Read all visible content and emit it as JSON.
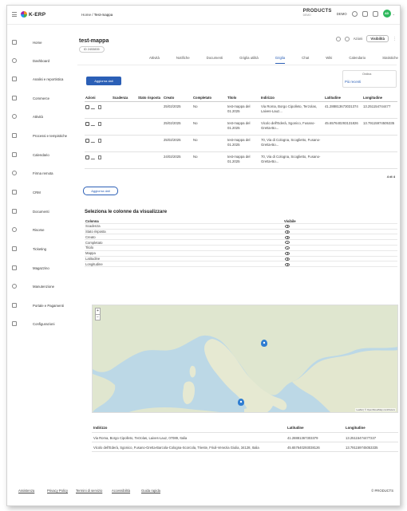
{
  "app": {
    "logo_text": "K-ERP"
  },
  "breadcrumb": {
    "home": "Home",
    "sep": "/",
    "current": "Test-mappa"
  },
  "header": {
    "product_name": "PRODUCTS",
    "product_sub": "DEMO",
    "org": "DEMO",
    "avatar_text": "AD"
  },
  "sidebar": {
    "items": [
      {
        "label": "Home",
        "icon": "home-icon"
      },
      {
        "label": "Dashboard",
        "icon": "dashboard-icon"
      },
      {
        "label": "Analisi e reportistica",
        "icon": "chart-icon"
      },
      {
        "label": "Commerce",
        "icon": "cart-icon"
      },
      {
        "label": "Attività",
        "icon": "activity-icon"
      },
      {
        "label": "Processi e tempistiche",
        "icon": "hourglass-icon"
      },
      {
        "label": "Calendario",
        "icon": "calendar-icon"
      },
      {
        "label": "Firma remota",
        "icon": "signature-icon"
      },
      {
        "label": "CRM",
        "icon": "crm-icon"
      },
      {
        "label": "Documenti",
        "icon": "document-icon"
      },
      {
        "label": "Risorse",
        "icon": "resources-icon"
      },
      {
        "label": "Ticketing",
        "icon": "ticket-icon"
      },
      {
        "label": "Magazzino",
        "icon": "warehouse-icon"
      },
      {
        "label": "Manutenzione",
        "icon": "wrench-icon"
      },
      {
        "label": "Portale e Pagamenti",
        "icon": "portal-icon"
      },
      {
        "label": "Configurazioni",
        "icon": "gear-icon"
      }
    ]
  },
  "page": {
    "title": "test-mappa",
    "id_badge": "ID 2453835",
    "actions": {
      "menu_label": "Azioni",
      "select_value": "Visibilità"
    }
  },
  "tabs": [
    "Attività",
    "Notifiche",
    "Documenti",
    "Griglia utilità",
    "Griglia",
    "Chat",
    "Wiki",
    "Calendario",
    "Statistiche"
  ],
  "active_tab": "Griglia",
  "buttons": {
    "update_top": "Aggiorna dati",
    "update_bottom": "Aggiorna dati"
  },
  "filter": {
    "caption": "Ordina",
    "value": "Più recenti"
  },
  "grid": {
    "columns": [
      "Azioni",
      "Scadenza",
      "Stato risposta",
      "Creato",
      "Completato",
      "Titolo",
      "Indirizzo",
      "Latitudine",
      "Longitudine"
    ],
    "rows": [
      {
        "scadenza": "",
        "stato": "",
        "creato": "25/02/2025",
        "completato": "No",
        "titolo": "test-mappa del 01.2025",
        "indirizzo": "Via Roma, Borgo Cipolleto, Terzolas, Laives-Lauz...",
        "lat": "41.288813673031374",
        "lon": "13.251154744477"
      },
      {
        "scadenza": "",
        "stato": "",
        "creato": "25/02/2025",
        "completato": "No",
        "titolo": "test-mappa del 01.2025",
        "indirizzo": "Vicolo dell'Ederà, Sgonico, Fusano-Gretta-Bo...",
        "lat": "45.657640293131826",
        "lon": "13.79115974505335"
      },
      {
        "scadenza": "",
        "stato": "",
        "creato": "25/02/2025",
        "completato": "No",
        "titolo": "test-mappa del 01.2025",
        "indirizzo": "70, Via di Cologna, Scoglietto, Fusano-Gretta-Bo...",
        "lat": "",
        "lon": ""
      },
      {
        "scadenza": "",
        "stato": "",
        "creato": "24/02/2025",
        "completato": "No",
        "titolo": "test-mappa del 01.2025",
        "indirizzo": "70, Via di Cologna, Scoglietto, Fusano-Gretta-Bo...",
        "lat": "",
        "lon": ""
      }
    ],
    "page_indicator": "4 di 4"
  },
  "column_picker": {
    "title": "Seleziona le colonne da visualizzare",
    "head_name": "Colonna",
    "head_visible": "Visibile",
    "items": [
      "Scadenza",
      "Stato risposta",
      "Creato",
      "Completato",
      "Titolo",
      "Mappa",
      "Latitudine",
      "Longitudine"
    ]
  },
  "map": {
    "zoom_in": "+",
    "zoom_out": "−",
    "attribution": "Leaflet | © OpenStreetMap contributors"
  },
  "addresses": {
    "head": {
      "indirizzo": "Indirizzo",
      "lat": "Latitudine",
      "lon": "Longitudine"
    },
    "rows": [
      {
        "indirizzo": "Via Roma, Borgo Cipolleto, Terzolas, Laives-Lauz, 07089, Italia",
        "lat": "41.28881367303379",
        "lon": "13.25115474477227"
      },
      {
        "indirizzo": "Vicolo dell'Ederà, Sgonico, Fusano-Gretta-Barcola-Cologna-Scorcola, Trieste, Friuli-Venezia Giulia, 34128, Italia",
        "lat": "45.657640293038126",
        "lon": "13.791159745053335"
      }
    ]
  },
  "footer": {
    "links": [
      "Assistenza",
      "Privacy Policy",
      "Termini di servizio",
      "Accessibilità",
      "Guida rapida"
    ],
    "right": "© PRODUCTS"
  },
  "colors": {
    "accent": "#2b5fb6",
    "sea": "#bcd8e6",
    "land": "#dfe6cf",
    "marker": "#2f7dd1",
    "avatar": "#2eb85c"
  }
}
